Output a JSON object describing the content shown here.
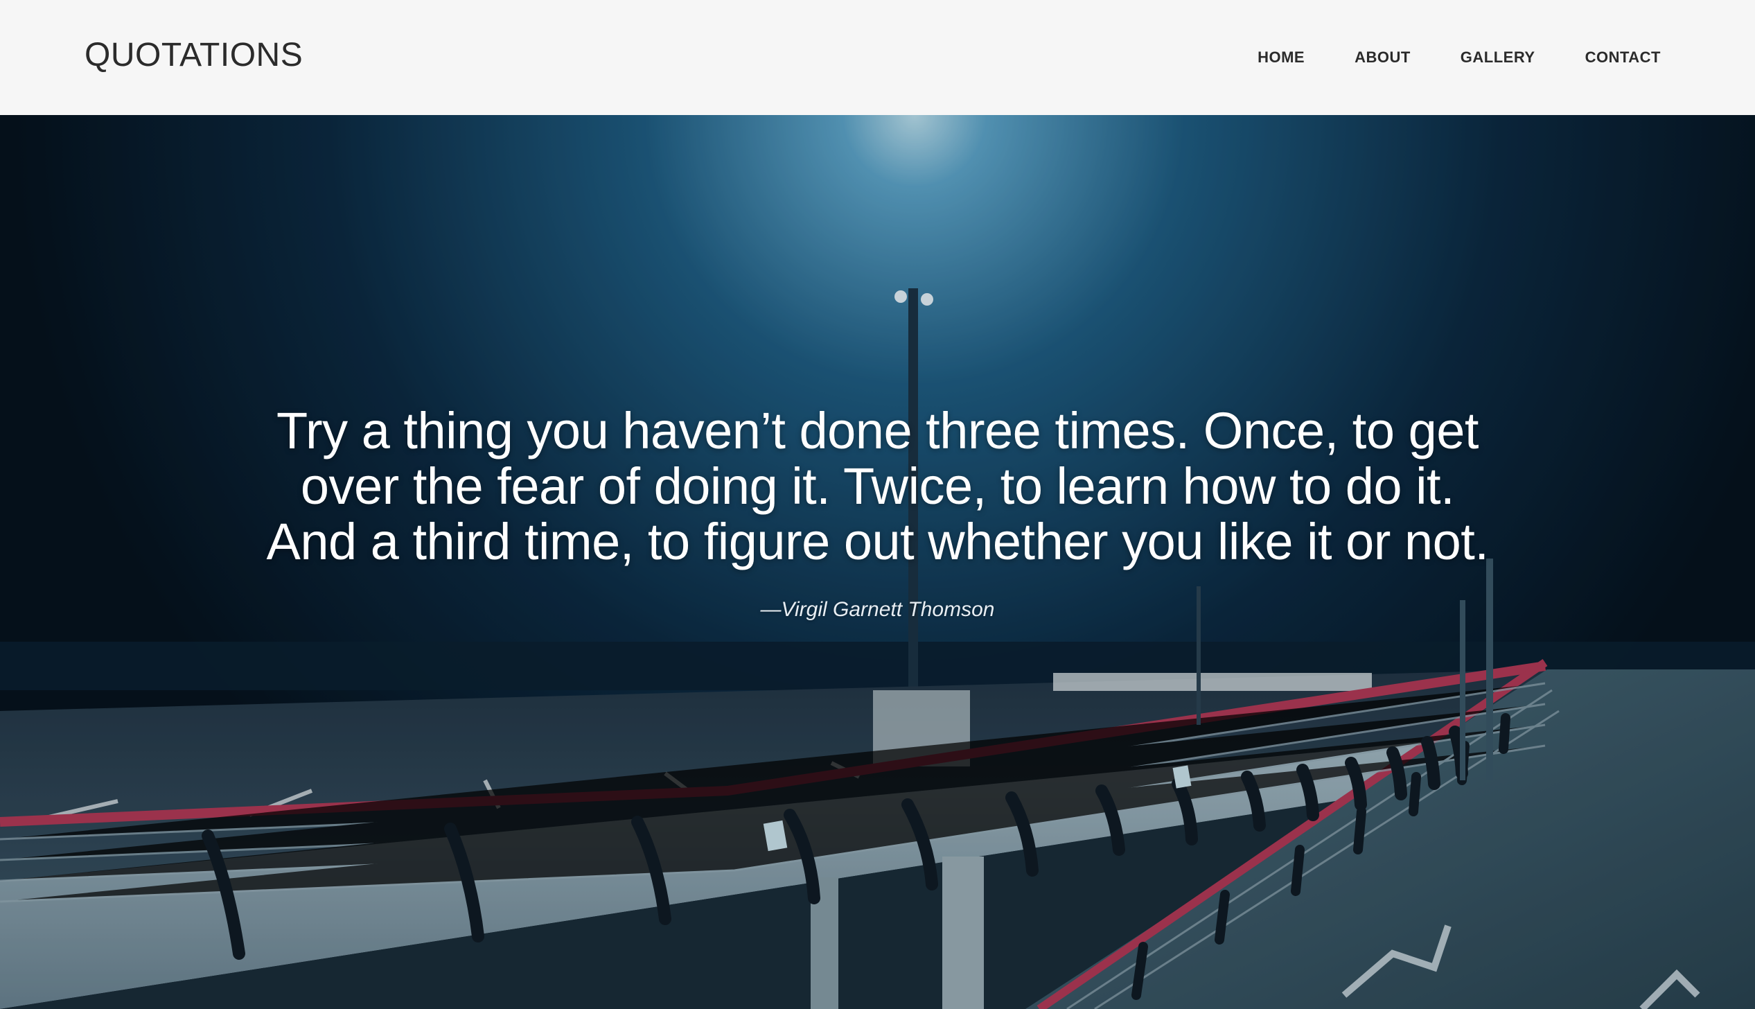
{
  "header": {
    "brand": "QUOTATIONS",
    "nav": [
      {
        "label": "HOME"
      },
      {
        "label": "ABOUT"
      },
      {
        "label": "GALLERY"
      },
      {
        "label": "CONTACT"
      }
    ]
  },
  "hero": {
    "quote_lines": [
      "Try a thing you haven’t done three times. Once, to get",
      "over the fear of doing it. Twice, to learn how to do it.",
      "And a third time, to figure out whether you like it or not."
    ],
    "author": "—Virgil Garnett Thomson",
    "background": "night parking deck with street lamp and railings",
    "colors": {
      "sky_dark": "#081a2b",
      "sky_glow": "#2f7fae",
      "railing": "#b73b5a",
      "concrete": "#8fa7b3"
    }
  }
}
